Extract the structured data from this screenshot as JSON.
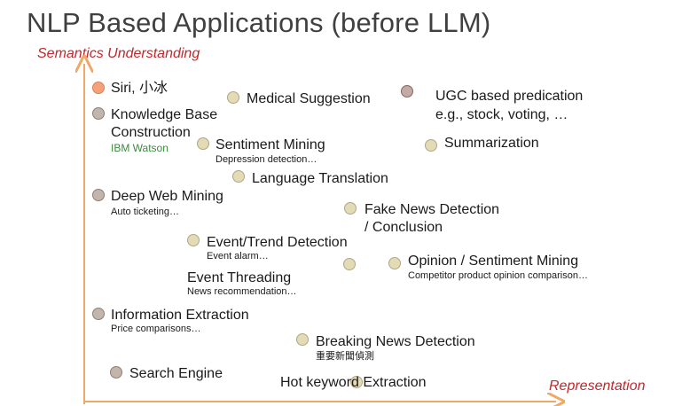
{
  "title": "NLP Based Applications (before LLM)",
  "axes": {
    "y_label": "Semantics Understanding",
    "x_label": "Representation"
  },
  "items": {
    "siri": {
      "label": "Siri, 小冰"
    },
    "kb": {
      "label_line1": "Knowledge Base",
      "label_line2": "Construction",
      "sub": "IBM Watson"
    },
    "medical": {
      "label": "Medical Suggestion"
    },
    "ugc": {
      "label_line1": "UGC based predication",
      "label_line2": "e.g., stock, voting, …"
    },
    "sentiment": {
      "label": "Sentiment Mining",
      "sub": "Depression detection…"
    },
    "summarization": {
      "label": "Summarization"
    },
    "translation": {
      "label": "Language Translation"
    },
    "deepweb": {
      "label": "Deep Web Mining",
      "sub": "Auto ticketing…"
    },
    "fakenews": {
      "label_line1": "Fake News Detection",
      "label_line2": "/ Conclusion"
    },
    "event_trend": {
      "label": "Event/Trend Detection",
      "sub": "Event alarm…"
    },
    "opinion": {
      "label": "Opinion / Sentiment Mining",
      "sub": "Competitor product opinion comparison…"
    },
    "threading": {
      "label": "Event Threading",
      "sub": "News recommendation…"
    },
    "info_extraction": {
      "label": "Information Extraction",
      "sub": "Price comparisons…"
    },
    "breaking": {
      "label": "Breaking News Detection",
      "sub": "重要新聞偵測"
    },
    "search": {
      "label": "Search Engine"
    },
    "hotkeyword": {
      "label": "Hot keyword Extraction"
    }
  },
  "colors": {
    "accent_red": "#c0282e",
    "axis": "#f0a868",
    "dot_orange": "#f5a27a",
    "dot_grey": "#c2b5ac",
    "dot_beige": "#e2dbb6",
    "dot_mauve": "#c4aaa4"
  }
}
